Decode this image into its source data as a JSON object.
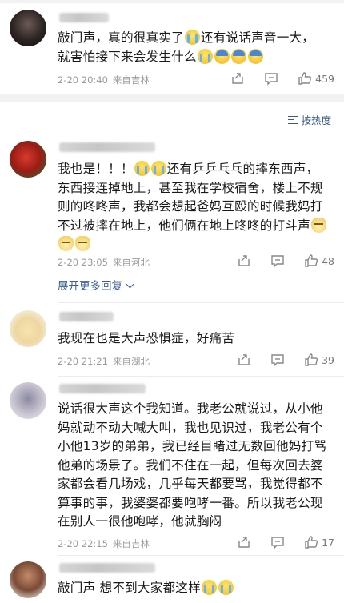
{
  "sort": {
    "label": "按热度"
  },
  "comments": [
    {
      "lines": [
        "敲门声，真的很真实了[cry]还有说话声音一大，",
        "就害怕接下来会发生什么[cry][fear][fear][fear]"
      ],
      "time": "2-20 20:40",
      "source": "来自吉林",
      "likes": "459"
    },
    {
      "lines": [
        "我也是！！！[cry][cry]还有乒乒乓乓的摔东西声，",
        "东西接连掉地上，甚至我在学校宿舍，楼上不规",
        "则的咚咚声，我都会想起爸妈互殴的时候我妈打",
        "不过被摔在地上，他们俩在地上咚咚的打斗声[cat]",
        "[cat][cat]"
      ],
      "time": "2-20 23:05",
      "source": "来自河北",
      "likes": "48",
      "more": "展开更多回复"
    },
    {
      "lines": [
        "我现在也是大声恐惧症，好痛苦"
      ],
      "time": "2-20 21:21",
      "source": "来自湖北",
      "likes": "39"
    },
    {
      "lines": [
        "说话很大声这个我知道。我老公就说过，从小他",
        "妈就动不动大喊大叫，我也见识过，我老公有个",
        "小他13岁的弟弟，我已经目睹过无数回他妈打骂",
        "他弟的场景了。我们不住在一起，但每次回去婆",
        "家都会看几场戏，几乎每天都要骂，我觉得都不",
        "算事的事，我婆婆都要咆哮一番。所以我老公现",
        "在别人一很他咆哮，他就胸闷"
      ],
      "time": "2-20 22:15",
      "source": "来自吉林",
      "likes": "17"
    },
    {
      "lines": [
        "敲门声 想不到大家都这样[cry][cry]"
      ],
      "time": "",
      "source": "",
      "likes": ""
    }
  ],
  "colors": {
    "link": "#3c5f95",
    "meta": "#9a9a9a",
    "divider": "#f2f2f2"
  },
  "icons": [
    "share-icon",
    "comment-icon",
    "like-icon",
    "sort-icon"
  ]
}
